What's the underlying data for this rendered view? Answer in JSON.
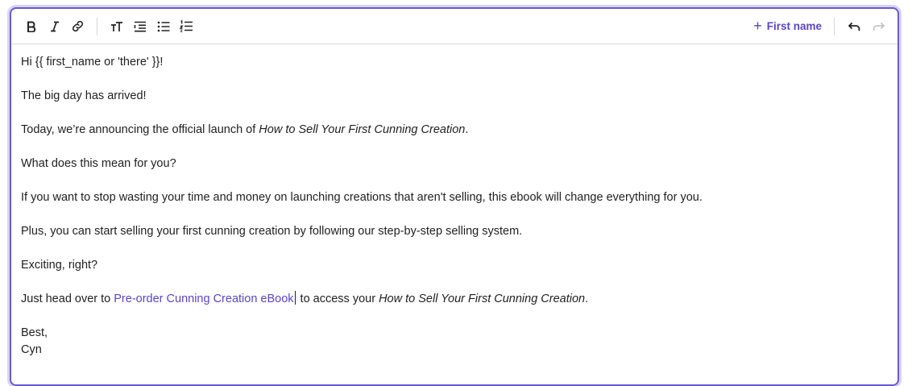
{
  "toolbar": {
    "buttons": [
      "bold-icon",
      "italic-icon",
      "link-icon",
      "text-size-icon",
      "indent-list-icon",
      "bullet-list-icon",
      "numbered-list-icon"
    ],
    "first_name_label": "First name",
    "first_name_plus": "+",
    "undo_icon": "undo-icon",
    "redo_icon": "redo-icon"
  },
  "content": {
    "greeting": "Hi {{ first_name or 'there' }}!",
    "line2": "The big day has arrived!",
    "line3_pre": "Today, we’re announcing the official launch of ",
    "line3_italic": "How to Sell Your First Cunning Creation",
    "line3_post": ".",
    "line4": "What does this mean for you?",
    "line5": "If you want to stop wasting your time and money on launching creations that aren't selling, this ebook will change everything for you.",
    "line6": "Plus, you can start selling your first cunning creation by following our step-by-step selling system.",
    "line7": "Exciting, right?",
    "line8_pre": "Just head over to ",
    "line8_link": "Pre-order Cunning Creation eBook",
    "line8_mid": " to access your ",
    "line8_italic": "How to Sell Your First Cunning Creation",
    "line8_post": ".",
    "signoff": "Best,",
    "signature": "Cyn"
  },
  "colors": {
    "accent": "#5b45c6",
    "border": "#6a5acd",
    "focus_ring": "#d8d3f5"
  }
}
